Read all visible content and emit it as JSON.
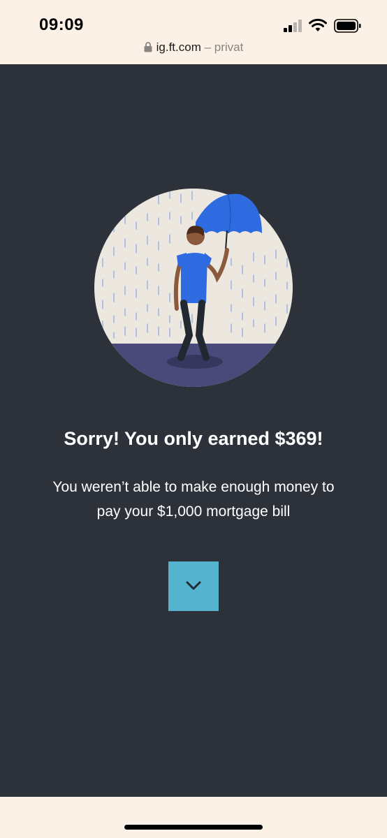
{
  "status_bar": {
    "time": "09:09"
  },
  "browser": {
    "url": "ig.ft.com",
    "mode_label": "– privat"
  },
  "main": {
    "headline": "Sorry! You only earned $369!",
    "body_line1": "You weren’t able to make enough money to",
    "body_line2": "pay your $1,000 mortgage bill",
    "next_button_icon": "chevron-down-icon"
  },
  "colors": {
    "page_background": "#2c313a",
    "browser_chrome": "#fcf1e6",
    "button_accent": "#54b4cf",
    "umbrella_blue": "#2f6be0"
  }
}
